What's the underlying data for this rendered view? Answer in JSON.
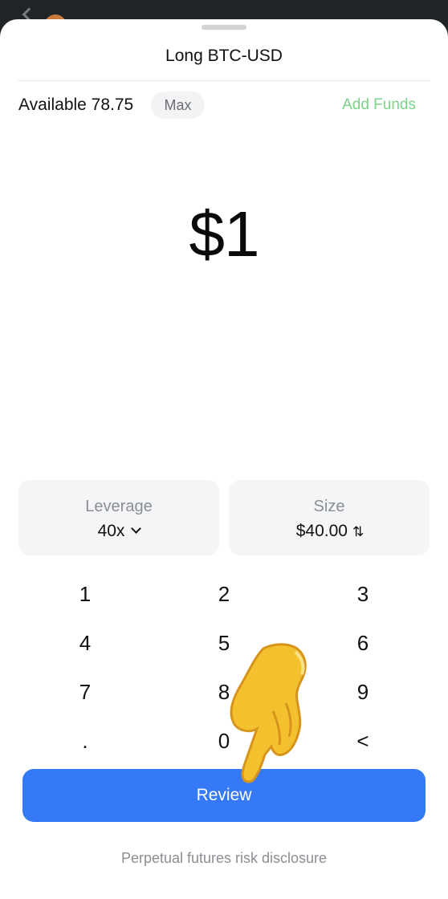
{
  "header": {
    "title": "Long BTC-USD"
  },
  "balance": {
    "available_text": "Available 78.75",
    "max_label": "Max",
    "add_funds_label": "Add Funds"
  },
  "amount": {
    "display": "$1"
  },
  "leverage": {
    "label": "Leverage",
    "value": "40x"
  },
  "size": {
    "label": "Size",
    "value": "$40.00",
    "swap_icon": "⇅"
  },
  "keypad": [
    "1",
    "2",
    "3",
    "4",
    "5",
    "6",
    "7",
    "8",
    "9",
    ".",
    "0",
    "<"
  ],
  "review_label": "Review",
  "disclosure_link": "Perpetual futures risk disclosure",
  "colors": {
    "accent_blue": "#3579f6",
    "add_funds_green": "#7bd389"
  }
}
